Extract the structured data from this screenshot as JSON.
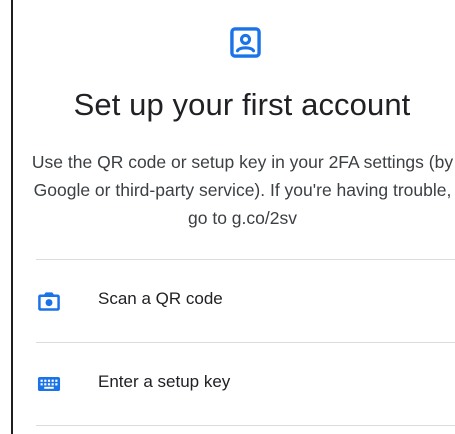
{
  "header": {
    "icon": "account-box-icon",
    "title": "Set up your first account",
    "description": "Use the QR code or setup key in your 2FA settings (by Google or third-party service). If you're having trouble, go to g.co/2sv"
  },
  "options": [
    {
      "icon": "camera-icon",
      "label": "Scan a QR code"
    },
    {
      "icon": "keyboard-icon",
      "label": "Enter a setup key"
    }
  ],
  "colors": {
    "accent": "#1a73e8",
    "divider": "#dadce0",
    "text": "#202124",
    "secondary_text": "#3c4043"
  }
}
